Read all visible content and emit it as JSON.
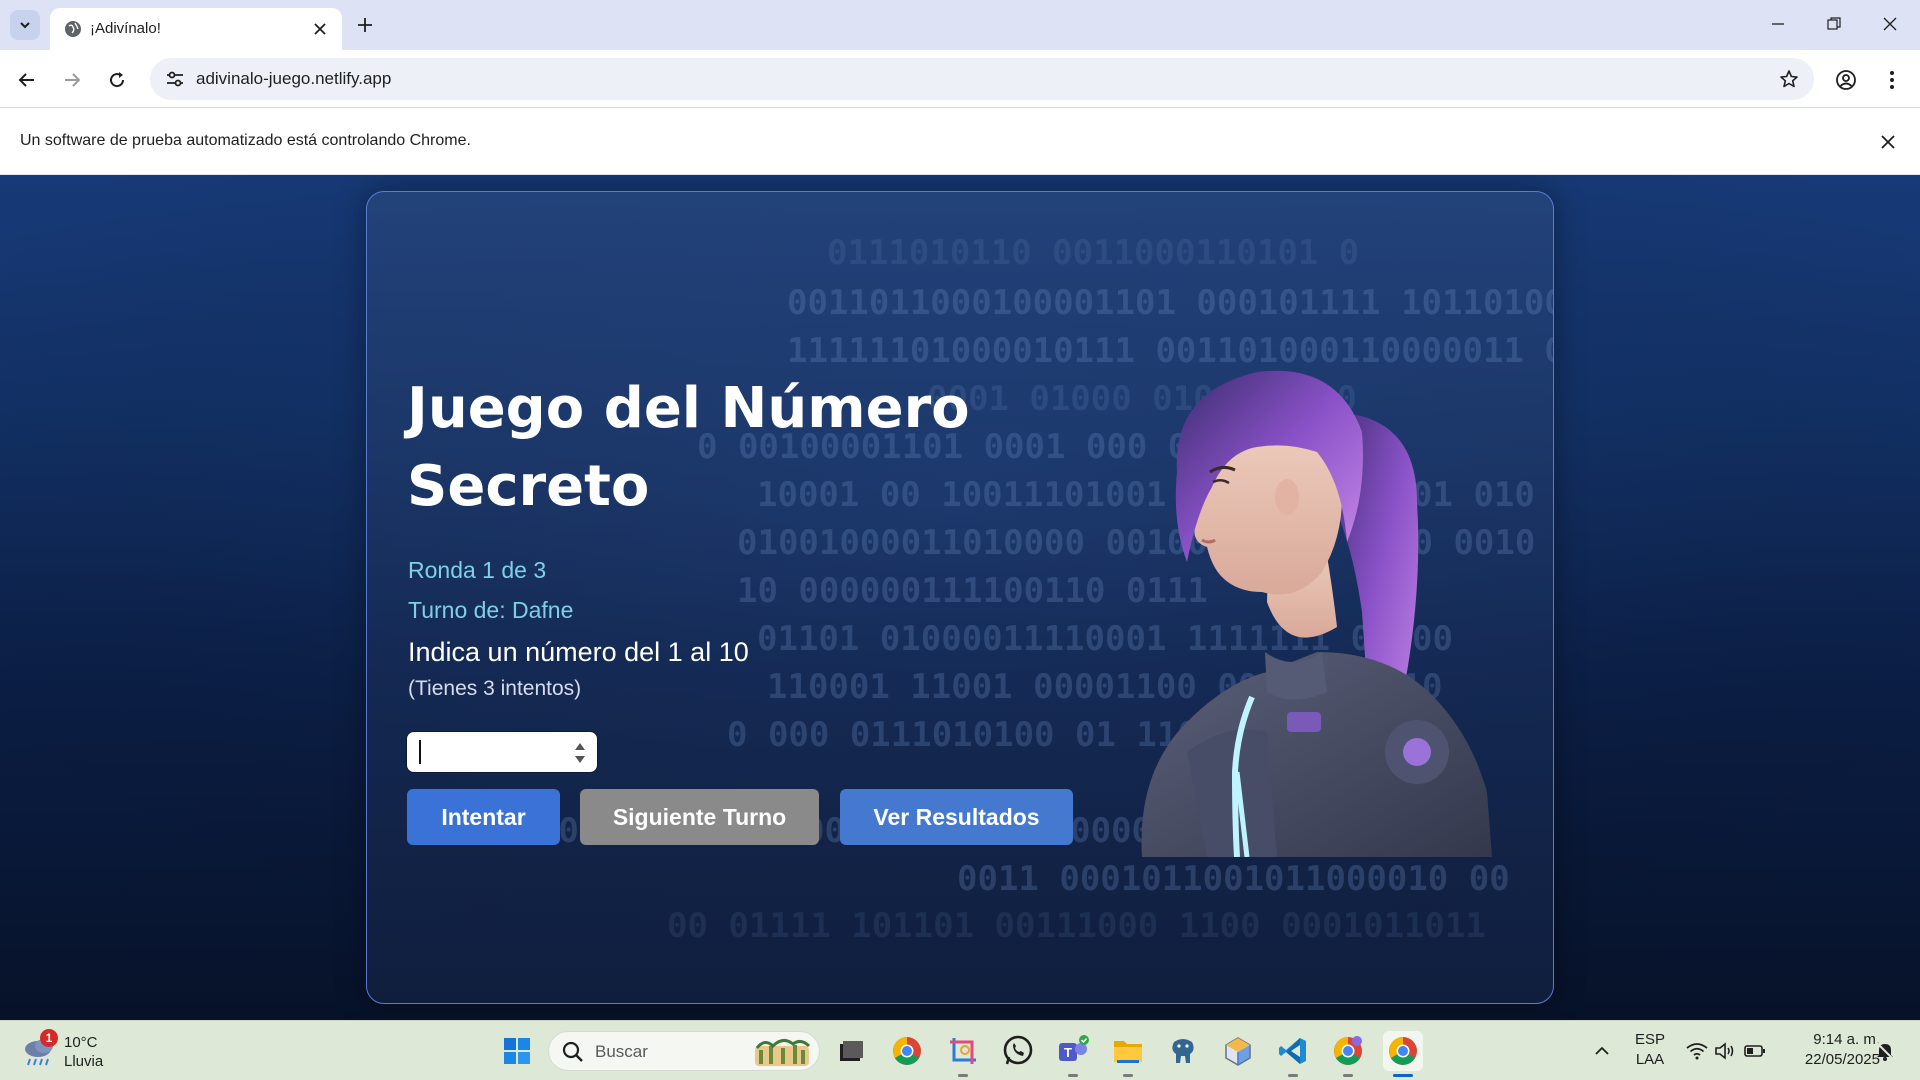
{
  "browser": {
    "tab": {
      "title": "¡Adivínalo!"
    },
    "url": "adivinalo-juego.netlify.app",
    "infobar_text": "Un software de prueba automatizado está controlando Chrome."
  },
  "game": {
    "title": "Juego del Número Secreto",
    "round": "Ronda 1 de 3",
    "turn": "Turno de: Dafne",
    "instruction": "Indica un número del 1 al 10",
    "attempts": "(Tienes 3 intentos)",
    "input_value": "",
    "buttons": {
      "try": "Intentar",
      "next_turn": "Siguiente Turno",
      "results": "Ver Resultados"
    },
    "colors": {
      "try": "#3b72d8",
      "next_turn": "#8a8a8a",
      "results": "#4479cf",
      "accent_text": "#7fd0e6"
    }
  },
  "taskbar": {
    "weather": {
      "temp": "10°C",
      "condition": "Lluvia",
      "badge": "1"
    },
    "search_placeholder": "Buscar",
    "language": {
      "line1": "ESP",
      "line2": "LAA"
    },
    "clock": {
      "time": "9:14 a. m.",
      "date": "22/05/2025"
    },
    "apps": [
      "windows-start",
      "task-view",
      "chrome",
      "snipping-tool",
      "whatsapp",
      "teams",
      "file-explorer",
      "postgresql",
      "box-app",
      "vscode",
      "chrome-profile",
      "chrome-active"
    ]
  }
}
